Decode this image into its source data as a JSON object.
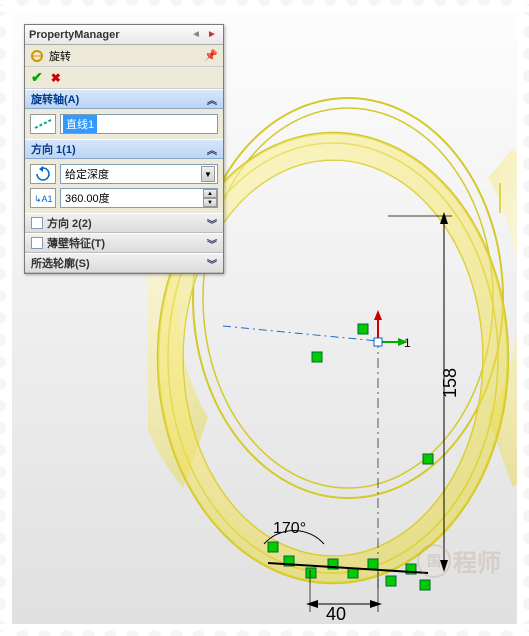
{
  "panel": {
    "title": "PropertyManager",
    "feature": "旋转",
    "sections": {
      "axis": {
        "header": "旋转轴(A)",
        "value": "直线1"
      },
      "direction1": {
        "header": "方向 1(1)",
        "type_label": "给定深度",
        "angle_value": "360.00度"
      },
      "direction2": {
        "header": "方向 2(2)"
      },
      "thin": {
        "header": "薄壁特征(T)"
      },
      "contour": {
        "header": "所选轮廓(S)"
      }
    }
  },
  "dimensions": {
    "height": "158",
    "width": "40",
    "angle": "170°"
  },
  "sketch": {
    "origin_label": "1"
  },
  "watermark": {
    "circle": "国",
    "text": "程师"
  }
}
